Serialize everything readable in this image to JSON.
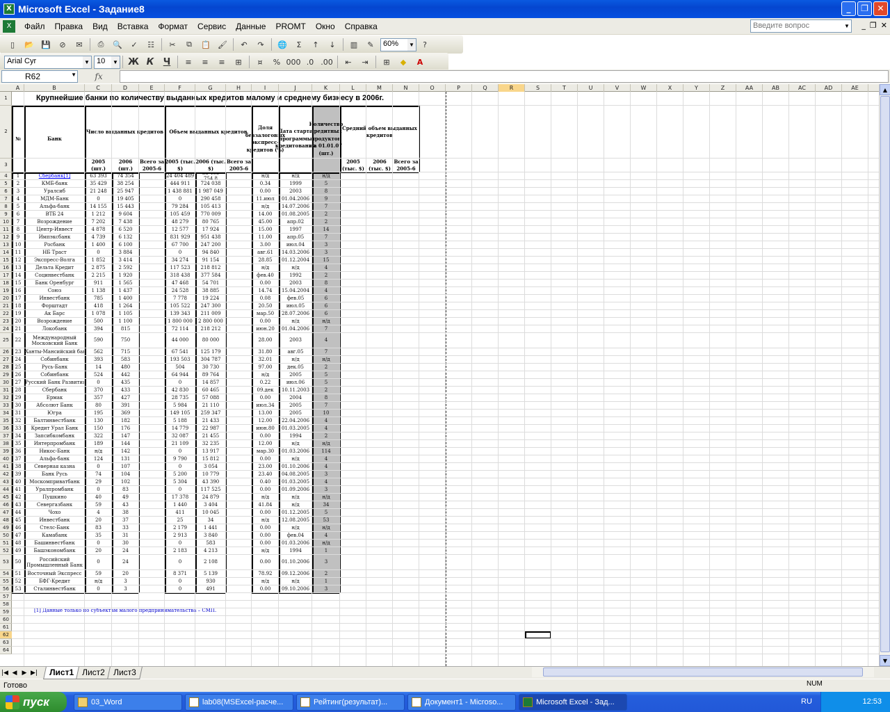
{
  "window": {
    "title": "Microsoft Excel - Задание8"
  },
  "menu": [
    "Файл",
    "Правка",
    "Вид",
    "Вставка",
    "Формат",
    "Сервис",
    "Данные",
    "PROMT",
    "Окно",
    "Справка"
  ],
  "ask_placeholder": "Введите вопрос",
  "toolbar": {
    "zoom": "60%",
    "font": "Arial Cyr",
    "size": "10",
    "bold": "Ж",
    "italic": "К",
    "underline": "Ч"
  },
  "namebox": "R62",
  "fx": "fx",
  "columns": [
    "A",
    "B",
    "C",
    "D",
    "E",
    "F",
    "G",
    "H",
    "I",
    "J",
    "K",
    "L",
    "M",
    "N",
    "O",
    "P",
    "Q",
    "R",
    "S",
    "T",
    "U",
    "V",
    "W",
    "X",
    "Y",
    "Z",
    "AA",
    "AB",
    "AC",
    "AD",
    "AE"
  ],
  "active_col": "R",
  "active_row": "62",
  "sheet": {
    "title": "Крупнейшие банки по количеству выданных кредитов малому и среднему бизнесу в 2006г.",
    "h_num": "№",
    "h_bank": "Банк",
    "h_count": "Число выданных кредитов",
    "h_volume": "Объем выданных кредитов",
    "h_share": "Доля беззалоговых экспресс-кредитов (%)",
    "h_start": "Дата старта программы кредитования",
    "h_qty": "Количество кредитных продуктов на 01.01.07 (шт.)",
    "h_avg": "Средний объем выданных кредитов",
    "s_2005": "2005 (шт.)",
    "s_2006": "2006 (шт.)",
    "s_total": "Всего за 2005-6",
    "s_v2005": "2005 (тыс. $)",
    "s_v2006": "2006 (тыс. $)",
    "s_vtotal": "Всего за 2005-6",
    "s_a2005": "2005 (тыс. $)",
    "s_a2006": "2006 (тыс. $)",
    "s_atotal": "Всего за 2005-6",
    "footnote": "[1] Данные только по субъектам малого предпринимательства – СМП."
  },
  "rows": [
    [
      "1",
      "Сбербанк[1]",
      "63 393",
      "74 354",
      "24 404 489",
      "33 408 754.8",
      "н/д",
      "н/д",
      "н/д"
    ],
    [
      "2",
      "КМБ-банк",
      "35 429",
      "38 254",
      "444 911",
      "724 038",
      "0.34",
      "1999",
      "5"
    ],
    [
      "3",
      "Уралсиб",
      "21 248",
      "25 947",
      "1 438 881",
      "1 987 049",
      "0.00",
      "2003",
      "8"
    ],
    [
      "4",
      "МДМ-Банк",
      "0",
      "19 405",
      "0",
      "290 458",
      "11.июл",
      "01.04.2006",
      "9"
    ],
    [
      "5",
      "Альфа-банк",
      "14 155",
      "15 443",
      "79 284",
      "105 413",
      "н/д",
      "14.07.2006",
      "7"
    ],
    [
      "6",
      "ВТБ 24",
      "1 212",
      "9 604",
      "105 459",
      "770 009",
      "14.00",
      "01.08.2005",
      "2"
    ],
    [
      "7",
      "Возрождение",
      "7 202",
      "7 438",
      "48 279",
      "80 765",
      "45.00",
      "апр.02",
      "2"
    ],
    [
      "8",
      "Центр-Инвест",
      "4 878",
      "6 520",
      "12 577",
      "17 924",
      "15.00",
      "1997",
      "14"
    ],
    [
      "9",
      "Импэксбанк",
      "4 739",
      "6 132",
      "831 929",
      "951 438",
      "11.00",
      "апр.05",
      "7"
    ],
    [
      "10",
      "Росбанк",
      "1 400",
      "6 100",
      "67 700",
      "247 200",
      "3.00",
      "июл.04",
      "3"
    ],
    [
      "11",
      "НБ Траст",
      "0",
      "3 884",
      "0",
      "94 840",
      "авг.61",
      "14.03.2006",
      "3"
    ],
    [
      "12",
      "Экспресс-Волга",
      "1 852",
      "3 414",
      "34 274",
      "91 154",
      "28.85",
      "01.12.2004",
      "15"
    ],
    [
      "13",
      "Дельта Кредит",
      "2 875",
      "2 592",
      "117 523",
      "218 812",
      "н/д",
      "н/д",
      "4"
    ],
    [
      "14",
      "Социнвестбанк",
      "2 215",
      "1 920",
      "318 438",
      "377 584",
      "фев.40",
      "1992",
      "2"
    ],
    [
      "15",
      "Банк Оренбург",
      "911",
      "1 565",
      "47 468",
      "54 701",
      "0.00",
      "2003",
      "8"
    ],
    [
      "16",
      "Союз",
      "1 138",
      "1 437",
      "24 528",
      "38 885",
      "14.74",
      "15.04.2004",
      "4"
    ],
    [
      "17",
      "Инвестбанк",
      "785",
      "1 400",
      "7 778",
      "19 224",
      "0.08",
      "фев.05",
      "6"
    ],
    [
      "18",
      "Форштадт",
      "418",
      "1 264",
      "105 522",
      "247 300",
      "20.50",
      "июл.05",
      "6"
    ],
    [
      "19",
      "Ак Барс",
      "1 078",
      "1 105",
      "139 343",
      "211 009",
      "мар.50",
      "28.07.2006",
      "6"
    ],
    [
      "20",
      "Возрождение",
      "500",
      "1 100",
      "1 800 000",
      "2 800 000",
      "0.00",
      "н/д",
      "н/д"
    ],
    [
      "21",
      "Локобанк",
      "394",
      "815",
      "72 114",
      "218 212",
      "июн.20",
      "01.04.2006",
      "7"
    ],
    [
      "22",
      "Международный Московский Банк",
      "590",
      "750",
      "44 000",
      "80 000",
      "28.00",
      "2003",
      "4"
    ],
    [
      "23",
      "Ханты-Мансийский банк",
      "562",
      "715",
      "67 541",
      "125 179",
      "31.80",
      "авг.05",
      "7"
    ],
    [
      "24",
      "Собинбанк",
      "393",
      "583",
      "193 503",
      "304 787",
      "32.01",
      "н/д",
      "н/д"
    ],
    [
      "25",
      "Русь-Банк",
      "14",
      "480",
      "504",
      "30 730",
      "97.00",
      "дек.05",
      "2"
    ],
    [
      "26",
      "Собинбанк",
      "524",
      "442",
      "64 944",
      "89 764",
      "н/д",
      "2005",
      "5"
    ],
    [
      "27",
      "Русский Банк Развития",
      "0",
      "435",
      "0",
      "14 857",
      "0.22",
      "июл.06",
      "5"
    ],
    [
      "28",
      "Сбербанк",
      "370",
      "433",
      "42 830",
      "60 465",
      "09.дек",
      "10.11.2003",
      "2"
    ],
    [
      "29",
      "Ермак",
      "357",
      "427",
      "28 735",
      "57 088",
      "0.00",
      "2004",
      "8"
    ],
    [
      "30",
      "Абсолют Банк",
      "80",
      "391",
      "5 984",
      "21 110",
      "июл.34",
      "2005",
      "7"
    ],
    [
      "31",
      "Югра",
      "195",
      "369",
      "149 105",
      "259 347",
      "13.00",
      "2005",
      "10"
    ],
    [
      "32",
      "Балтинвестбанк",
      "130",
      "182",
      "5 188",
      "21 433",
      "12.00",
      "22.04.2006",
      "4"
    ],
    [
      "33",
      "Кредит Урал Банк",
      "150",
      "176",
      "14 779",
      "22 987",
      "июн.80",
      "01.03.2005",
      "4"
    ],
    [
      "34",
      "Запсибкомбанк",
      "322",
      "147",
      "32 087",
      "21 455",
      "0.00",
      "1994",
      "2"
    ],
    [
      "35",
      "Интерпромбанк",
      "189",
      "144",
      "21 109",
      "32 235",
      "12.00",
      "н/д",
      "н/д"
    ],
    [
      "36",
      "Никос-Банк",
      "н/д",
      "142",
      "0",
      "13 917",
      "мар.30",
      "01.03.2006",
      "114"
    ],
    [
      "37",
      "Альфа-банк",
      "124",
      "131",
      "9 790",
      "15 812",
      "0.00",
      "н/д",
      "4"
    ],
    [
      "38",
      "Северная казна",
      "0",
      "107",
      "0",
      "3 054",
      "23.00",
      "01.10.2006",
      "4"
    ],
    [
      "39",
      "Банк Русь",
      "74",
      "104",
      "5 200",
      "10 779",
      "23.40",
      "04.08.2005",
      "3"
    ],
    [
      "40",
      "Москомприватбанк",
      "29",
      "102",
      "5 304",
      "43 390",
      "0.40",
      "01.03.2005",
      "4"
    ],
    [
      "41",
      "Уралпромбанк",
      "0",
      "83",
      "0",
      "117 525",
      "0.00",
      "01.09.2006",
      "3"
    ],
    [
      "42",
      "Пушкино",
      "40",
      "49",
      "17 378",
      "24 879",
      "н/д",
      "н/д",
      "н/д"
    ],
    [
      "43",
      "Севергазбанк",
      "59",
      "43",
      "1 440",
      "3 404",
      "41.84",
      "н/д",
      "34"
    ],
    [
      "44",
      "Чохо",
      "4",
      "38",
      "411",
      "10 045",
      "0.00",
      "01.12.2005",
      "5"
    ],
    [
      "45",
      "Инвестбанк",
      "20",
      "37",
      "25",
      "34",
      "н/д",
      "12.08.2005",
      "53"
    ],
    [
      "46",
      "Стелс-Банк",
      "83",
      "33",
      "2 179",
      "1 441",
      "0.00",
      "н/д",
      "н/д"
    ],
    [
      "47",
      "Камабанк",
      "35",
      "31",
      "2 913",
      "3 840",
      "0.00",
      "фев.04",
      "4"
    ],
    [
      "48",
      "Башинвестбанк",
      "0",
      "30",
      "0",
      "583",
      "0.00",
      "01.03.2006",
      "н/д"
    ],
    [
      "49",
      "Башэкономбанк",
      "20",
      "24",
      "2 183",
      "4 213",
      "н/д",
      "1994",
      "1"
    ],
    [
      "50",
      "Российский Промышленный Банк",
      "0",
      "24",
      "0",
      "2 108",
      "0.00",
      "01.10.2006",
      "3"
    ],
    [
      "51",
      "Восточный Экспресс",
      "59",
      "20",
      "8 371",
      "5 139",
      "78.92",
      "09.12.2006",
      "2"
    ],
    [
      "52",
      "БФГ-Кредит",
      "н/д",
      "3",
      "0",
      "930",
      "н/д",
      "н/д",
      "1"
    ],
    [
      "53",
      "Сталинвестбанк",
      "0",
      "3",
      "0",
      "491",
      "0.00",
      "09.10.2006",
      "3"
    ]
  ],
  "sheets": [
    "Лист1",
    "Лист2",
    "Лист3"
  ],
  "status": {
    "ready": "Готово",
    "num": "NUM"
  },
  "taskbar": {
    "start": "пуск",
    "items": [
      "03_Word",
      "lab08(MSExcel-расче...",
      "Рейтинг(результат)...",
      "Документ1 - Microso...",
      "Microsoft Excel - Зад..."
    ],
    "lang": "RU",
    "time": "12:53"
  }
}
